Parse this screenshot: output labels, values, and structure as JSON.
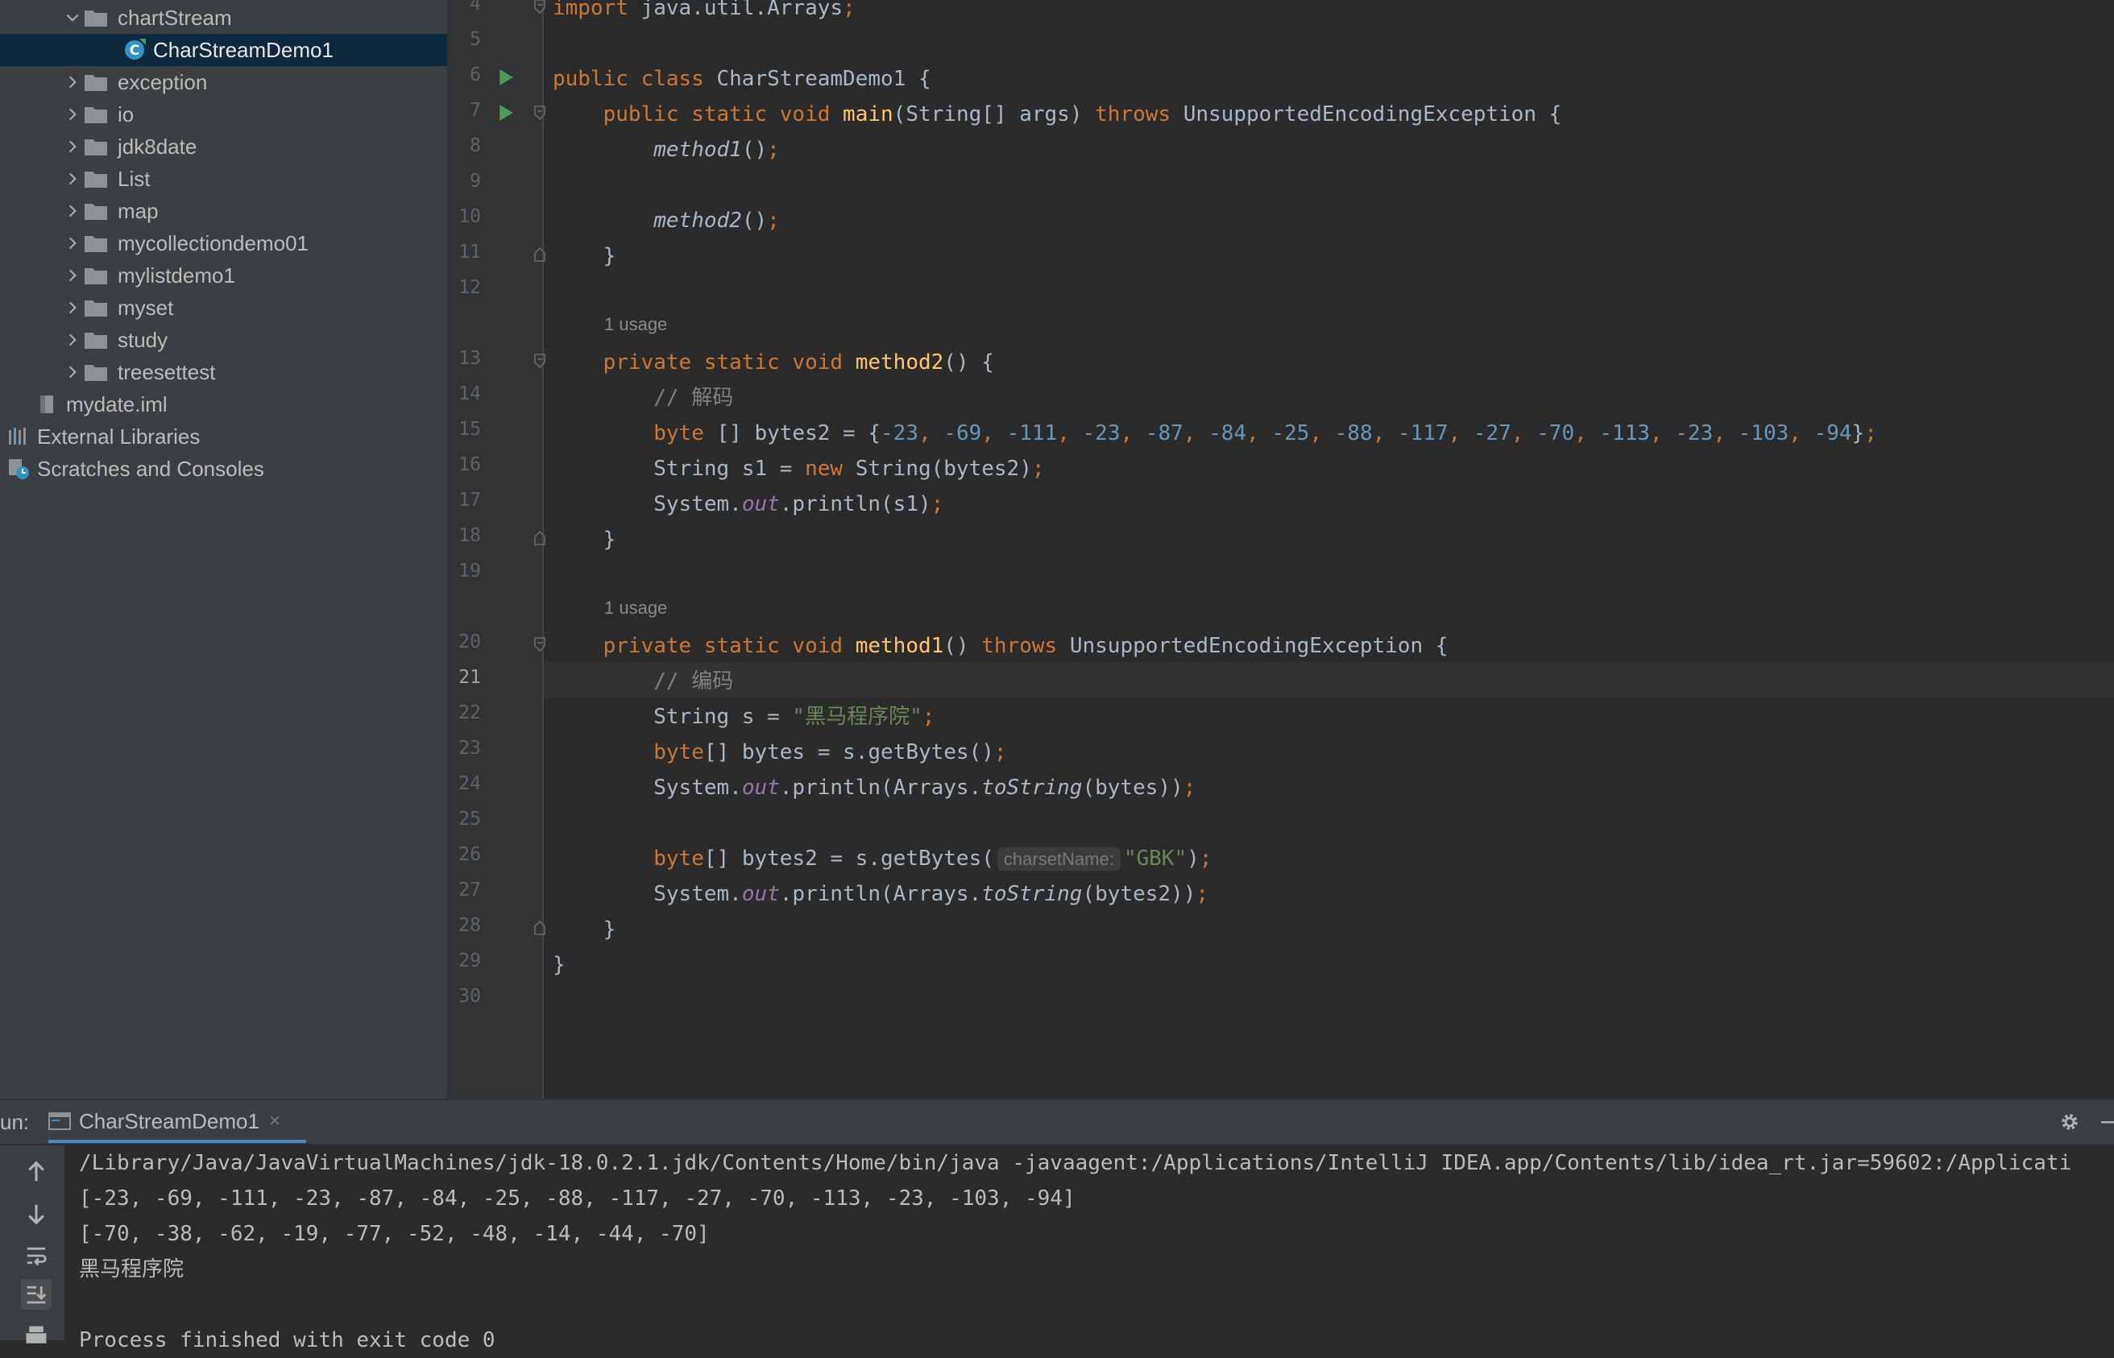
{
  "project_tree": {
    "items": [
      {
        "label": "chartStream",
        "kind": "folder",
        "expanded": true
      },
      {
        "label": "CharStreamDemo1",
        "kind": "class",
        "selected": true
      },
      {
        "label": "exception",
        "kind": "folder"
      },
      {
        "label": "io",
        "kind": "folder"
      },
      {
        "label": "jdk8date",
        "kind": "folder"
      },
      {
        "label": "List",
        "kind": "folder"
      },
      {
        "label": "map",
        "kind": "folder"
      },
      {
        "label": "mycollectiondemo01",
        "kind": "folder"
      },
      {
        "label": "mylistdemo1",
        "kind": "folder"
      },
      {
        "label": "myset",
        "kind": "folder"
      },
      {
        "label": "study",
        "kind": "folder"
      },
      {
        "label": "treesettest",
        "kind": "folder"
      },
      {
        "label": "mydate.iml",
        "kind": "iml"
      },
      {
        "label": "External Libraries",
        "kind": "libraries"
      },
      {
        "label": "Scratches and Consoles",
        "kind": "scratches"
      }
    ]
  },
  "editor": {
    "line_numbers": [
      "4",
      "5",
      "6",
      "7",
      "8",
      "9",
      "10",
      "11",
      "12",
      "13",
      "14",
      "15",
      "16",
      "17",
      "18",
      "19",
      "20",
      "21",
      "22",
      "23",
      "24",
      "25",
      "26",
      "27",
      "28",
      "29",
      "30"
    ],
    "current_line": "21",
    "usage_hints": [
      "1 usage",
      "1 usage"
    ],
    "param_hint": "charsetName:",
    "code": {
      "l4_kw": "import",
      "l4_rest": " java.util.Arrays",
      "l4_semi": ";",
      "l6_kw": "public class",
      "l6_rest": " CharStreamDemo1 {",
      "l7_kw": "public static void",
      "l7_fn": "main",
      "l7_args": "(String[] args) ",
      "l7_throws": "throws",
      "l7_rest": " UnsupportedEncodingException {",
      "l8_call": "method1",
      "l8_rest": "()",
      "l8_semi": ";",
      "l10_call": "method2",
      "l10_rest": "()",
      "l10_semi": ";",
      "l11": "}",
      "l13_kw": "private static void",
      "l13_fn": "method2",
      "l13_rest": "() {",
      "l14_cmt": "// 解码",
      "l15_kw": "byte",
      "l15_rest": " [] bytes2 = {",
      "l15_nums": [
        "-23",
        "-69",
        "-111",
        "-23",
        "-87",
        "-84",
        "-25",
        "-88",
        "-117",
        "-27",
        "-70",
        "-113",
        "-23",
        "-103",
        "-94"
      ],
      "l15_end": "}",
      "l16_a": "String s1 = ",
      "l16_kw": "new",
      "l16_b": " String(bytes2)",
      "l17_a": "System.",
      "l17_field": "out",
      "l17_b": ".println(s1)",
      "l18": "}",
      "l20_kw": "private static void",
      "l20_fn": "method1",
      "l20_mid": "() ",
      "l20_throws": "throws",
      "l20_rest": " UnsupportedEncodingException {",
      "l21_cmt": "// 编码",
      "l22_a": "String s = ",
      "l22_str": "\"黑马程序院\"",
      "l23_kw": "byte",
      "l23_rest": "[] bytes = s.getBytes()",
      "l24_a": "System.",
      "l24_field": "out",
      "l24_b": ".println(Arrays.",
      "l24_call": "toString",
      "l24_c": "(bytes))",
      "l26_kw": "byte",
      "l26_rest": "[] bytes2 = s.getBytes(",
      "l26_str": "\"GBK\"",
      "l26_end": ")",
      "l27_a": "System.",
      "l27_field": "out",
      "l27_b": ".println(Arrays.",
      "l27_call": "toString",
      "l27_c": "(bytes2))",
      "l28": "}",
      "l29": "}",
      "semi": ";"
    }
  },
  "run_panel": {
    "label": "un:",
    "tab_title": "CharStreamDemo1",
    "tab_close": "×",
    "output": [
      "/Library/Java/JavaVirtualMachines/jdk-18.0.2.1.jdk/Contents/Home/bin/java -javaagent:/Applications/IntelliJ IDEA.app/Contents/lib/idea_rt.jar=59602:/Applicati",
      "[-23, -69, -111, -23, -87, -84, -25, -88, -117, -27, -70, -113, -23, -103, -94]",
      "[-70, -38, -62, -19, -77, -52, -48, -14, -44, -70]",
      "黑马程序院",
      "",
      "Process finished with exit code 0"
    ]
  },
  "colors": {
    "sidebar_bg": "#3c3f41",
    "editor_bg": "#2b2b2b",
    "selection": "#0d293e",
    "keyword": "#cc7832",
    "function": "#ffc66d",
    "number": "#6897bb",
    "string": "#6a8759",
    "comment": "#808080",
    "field": "#9876aa",
    "run_green": "#499c54"
  }
}
